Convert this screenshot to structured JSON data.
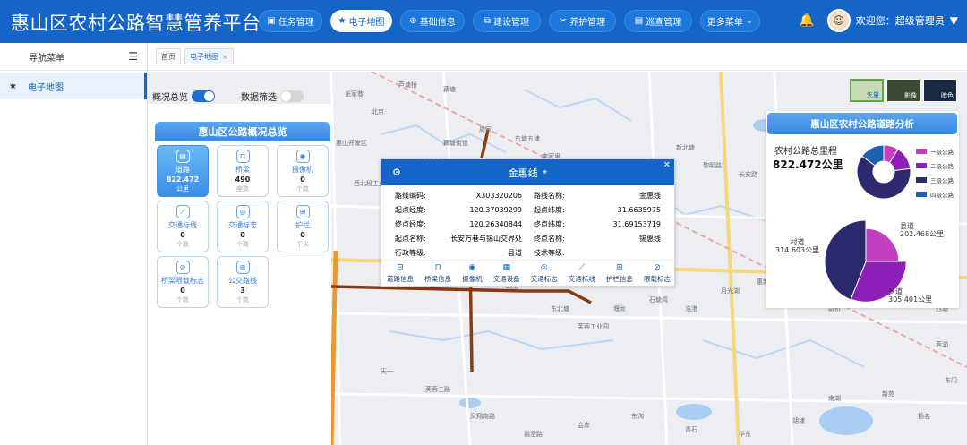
{
  "app": {
    "title": "惠山区农村公路智慧管养平台"
  },
  "nav": [
    {
      "label": "任务管理",
      "icon": "task-icon",
      "active": false
    },
    {
      "label": "电子地图",
      "icon": "star-icon",
      "active": true
    },
    {
      "label": "基础信息",
      "icon": "plus-circle-icon",
      "active": false
    },
    {
      "label": "建设管理",
      "icon": "build-icon",
      "active": false
    },
    {
      "label": "养护管理",
      "icon": "wrench-icon",
      "active": false
    },
    {
      "label": "巡查管理",
      "icon": "patrol-icon",
      "active": false
    },
    {
      "label": "更多菜单",
      "icon": "chevron-down-icon",
      "active": false
    }
  ],
  "user": {
    "greeting": "欢迎您：超级管理员"
  },
  "sidebar": {
    "title": "导航菜单",
    "items": [
      {
        "label": "电子地图"
      }
    ]
  },
  "tabs": [
    {
      "label": "首页"
    },
    {
      "label": "电子地图",
      "closable": true
    }
  ],
  "toggles": {
    "overview": "概况总览",
    "filter": "数据筛选"
  },
  "overview": {
    "title": "惠山区公路概况总览",
    "cards": [
      {
        "label": "道路",
        "value": "822.472",
        "unit": "公里",
        "icon": "road-icon",
        "active": true
      },
      {
        "label": "桥梁",
        "value": "490",
        "unit": "座数",
        "icon": "bridge-icon"
      },
      {
        "label": "摄像机",
        "value": "0",
        "unit": "个数",
        "icon": "camera-icon"
      },
      {
        "label": "交通标线",
        "value": "0",
        "unit": "个数",
        "icon": "marking-icon"
      },
      {
        "label": "交通标志",
        "value": "0",
        "unit": "个数",
        "icon": "sign-icon"
      },
      {
        "label": "护栏",
        "value": "0",
        "unit": "千米",
        "icon": "guardrail-icon"
      },
      {
        "label": "桥梁限载标志",
        "value": "0",
        "unit": "个数",
        "icon": "limit-icon"
      },
      {
        "label": "公交路线",
        "value": "3",
        "unit": "个数",
        "icon": "bus-icon"
      }
    ]
  },
  "popup": {
    "title": "金惠线",
    "fields": {
      "road_code_k": "路线编码:",
      "road_code_v": "X303320206",
      "road_name_k": "路线名称:",
      "road_name_v": "金惠线",
      "start_lng_k": "起点经度:",
      "start_lng_v": "120.37039299",
      "start_lat_k": "起点纬度:",
      "start_lat_v": "31.6635975",
      "end_lng_k": "终点经度:",
      "end_lng_v": "120.26340844",
      "end_lat_k": "终点纬度:",
      "end_lat_v": "31.69153719",
      "start_name_k": "起点名称:",
      "start_name_v": "长安万巷与锡山交界处",
      "end_name_k": "终点名称:",
      "end_name_v": "锡惠线",
      "admin_k": "行政等级:",
      "admin_v": "县道",
      "tech_k": "技术等级:",
      "tech_v": ""
    },
    "tools": [
      {
        "label": "道路信息",
        "icon": "road-info-icon"
      },
      {
        "label": "桥梁信息",
        "icon": "bridge-icon"
      },
      {
        "label": "摄像机",
        "icon": "camera-icon"
      },
      {
        "label": "交通设备",
        "icon": "device-icon"
      },
      {
        "label": "交通标志",
        "icon": "sign-icon"
      },
      {
        "label": "交通标线",
        "icon": "marking-icon"
      },
      {
        "label": "护栏信息",
        "icon": "guardrail-icon"
      },
      {
        "label": "限载标志",
        "icon": "limit-icon"
      }
    ]
  },
  "layers": [
    "矢量",
    "影像",
    "暗色"
  ],
  "map_labels": [
    "张家巷",
    "芦塘桥",
    "藕塘",
    "北京",
    "惠山开发区",
    "西北段工业区",
    "苏锡常石",
    "藕塘街道",
    "周家",
    "东塘五埭",
    "李家里",
    "东马",
    "坝桥",
    "东亭",
    "新北塘",
    "黎明路",
    "长安路",
    "东亭工业园",
    "海里工业园",
    "新开河",
    "宜沟",
    "堰桥",
    "前洲",
    "朝南",
    "东北塘",
    "芙蓉工业园",
    "堰龙",
    "石塘湾",
    "浩港",
    "月光湖",
    "惠新",
    "安镇",
    "新桥",
    "大西街",
    "梅村",
    "西塘",
    "天一",
    "芙蓉三路",
    "凤翔南路",
    "锡澄路",
    "会岸",
    "东沟",
    "青石",
    "华东",
    "胡埭",
    "南湖",
    "新苑",
    "扬名",
    "蓉湖",
    "东门"
  ],
  "analysis": {
    "title": "惠山区农村公路道路分析",
    "total_label": "农村公路总里程",
    "total_value": "822.472公里",
    "legend": [
      {
        "label": "一级公路",
        "color": "#c23fc0"
      },
      {
        "label": "二级公路",
        "color": "#8e1fb8"
      },
      {
        "label": "三级公路",
        "color": "#2b2a6e"
      },
      {
        "label": "四级公路",
        "color": "#1e5fb0"
      }
    ],
    "pie_labels": [
      {
        "name": "县道",
        "value": "202.468公里"
      },
      {
        "name": "乡道",
        "value": "305.401公里"
      },
      {
        "name": "村道",
        "value": "314.603公里"
      }
    ]
  },
  "chart_data": [
    {
      "type": "pie",
      "title": "",
      "categories": [
        "一级公路",
        "二级公路",
        "三级公路",
        "四级公路"
      ],
      "values": [
        9,
        14,
        62,
        15
      ],
      "colors": [
        "#c23fc0",
        "#8e1fb8",
        "#2b2a6e",
        "#1e5fb0"
      ],
      "legend": "right",
      "donut": true
    },
    {
      "type": "pie",
      "title": "",
      "categories": [
        "县道",
        "乡道",
        "村道"
      ],
      "values": [
        202.468,
        305.401,
        314.603
      ],
      "colors": [
        "#c23fc0",
        "#8e1fb8",
        "#2b2a6e"
      ],
      "rose": true
    }
  ]
}
